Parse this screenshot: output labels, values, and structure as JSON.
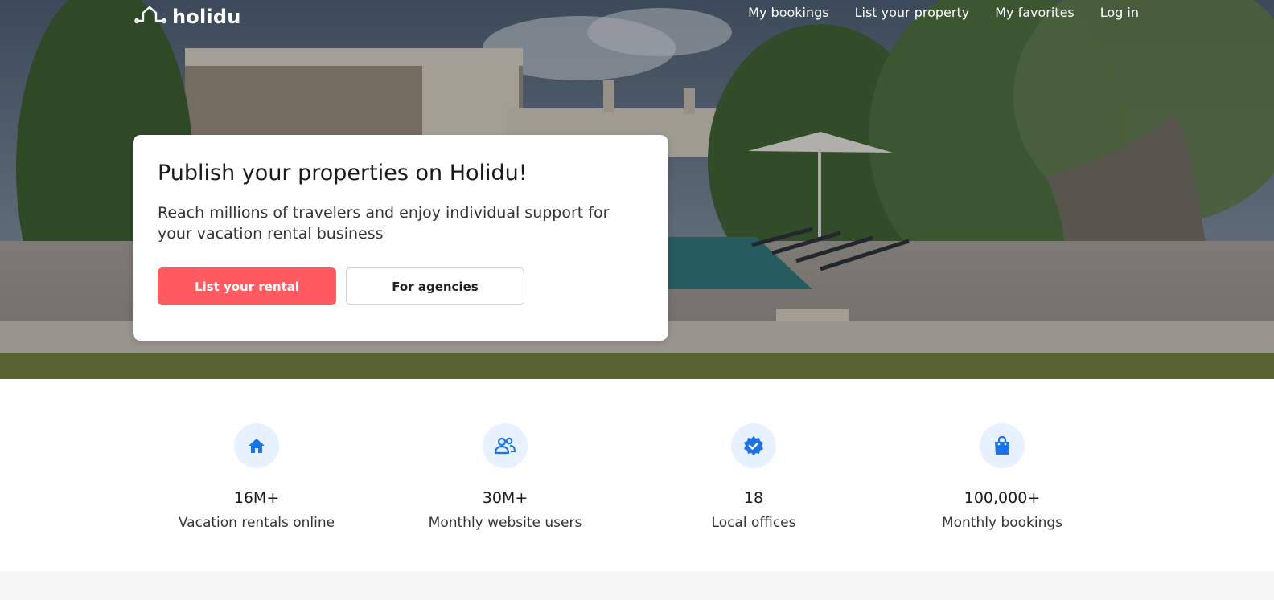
{
  "brand": {
    "name": "holidu"
  },
  "nav": {
    "links": [
      "My bookings",
      "List your property",
      "My favorites",
      "Log in"
    ]
  },
  "hero": {
    "title": "Publish your properties on Holidu!",
    "subtitle": "Reach millions of travelers and enjoy individual support for your vacation rental business",
    "primary_button": "List your rental",
    "secondary_button": "For agencies"
  },
  "stats": [
    {
      "icon": "home-icon",
      "value": "16M+",
      "label": "Vacation rentals online"
    },
    {
      "icon": "users-icon",
      "value": "30M+",
      "label": "Monthly website users"
    },
    {
      "icon": "verified-badge-icon",
      "value": "18",
      "label": "Local offices"
    },
    {
      "icon": "shopping-bag-icon",
      "value": "100,000+",
      "label": "Monthly bookings"
    }
  ],
  "colors": {
    "accent": "#ff5b61",
    "icon_blue": "#1a73e8",
    "icon_bg": "#e8f1ff"
  }
}
